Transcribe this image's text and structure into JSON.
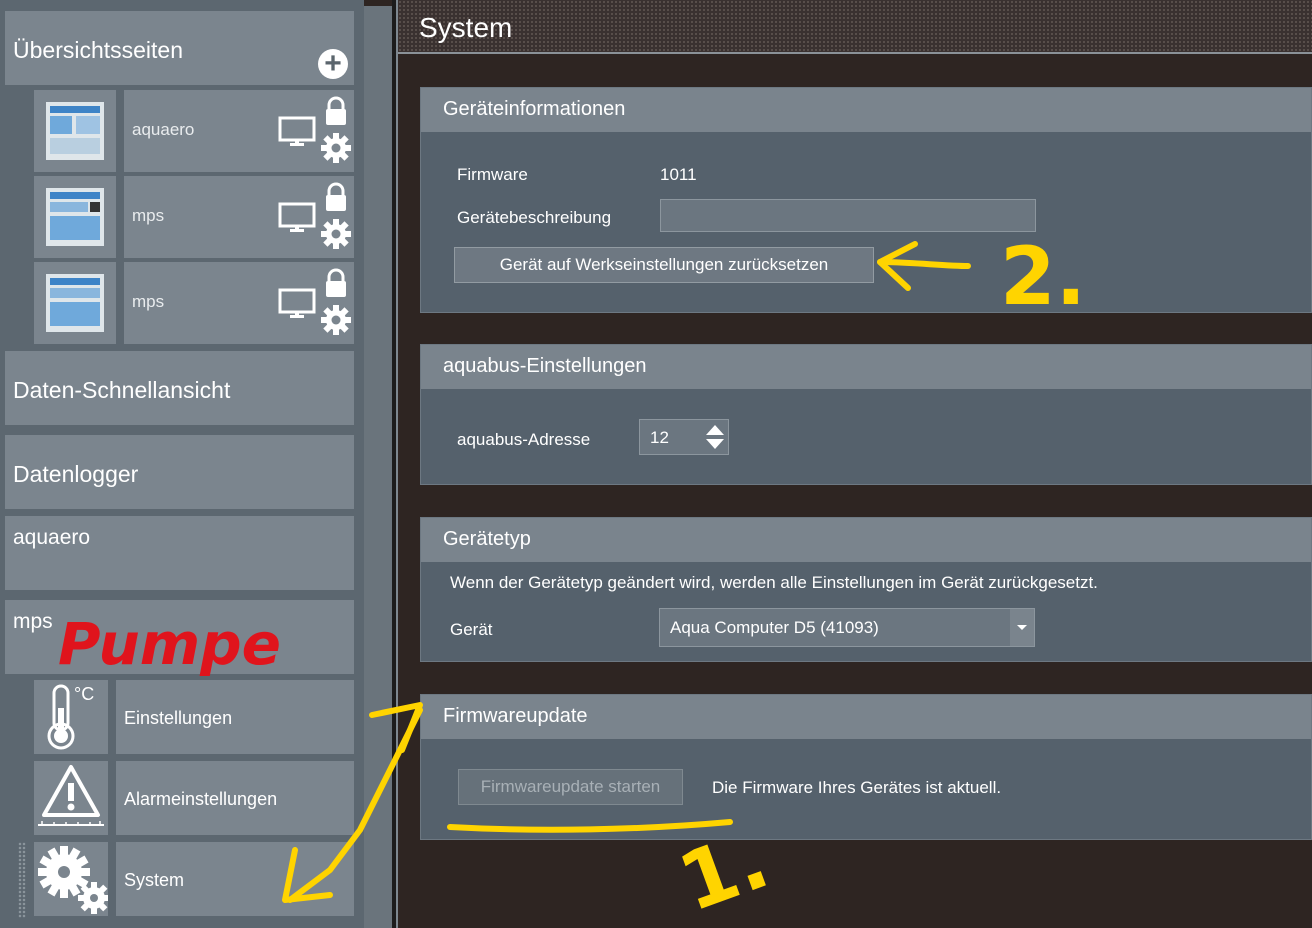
{
  "sidebar": {
    "overview_header": "Übersichtsseiten",
    "pages": [
      {
        "label": "aquaero"
      },
      {
        "label": "mps"
      },
      {
        "label": "mps"
      }
    ],
    "quick_view": "Daten-Schnellansicht",
    "datalogger": "Datenlogger",
    "device1": "aquaero",
    "device2": "mps",
    "sub_items": [
      {
        "label": "Einstellungen",
        "icon": "thermometer-icon"
      },
      {
        "label": "Alarmeinstellungen",
        "icon": "warning-icon"
      },
      {
        "label": "System",
        "icon": "gears-icon"
      }
    ],
    "celsius": "°C"
  },
  "title": "System",
  "sections": {
    "device_info": {
      "header": "Geräteinformationen",
      "firmware_label": "Firmware",
      "firmware_value": "1011",
      "description_label": "Gerätebeschreibung",
      "description_value": "",
      "reset_button": "Gerät auf Werkseinstellungen zurücksetzen"
    },
    "aquabus": {
      "header": "aquabus-Einstellungen",
      "address_label": "aquabus-Adresse",
      "address_value": "12"
    },
    "device_type": {
      "header": "Gerätetyp",
      "warning": "Wenn der Gerätetyp geändert wird, werden alle Einstellungen im Gerät zurückgesetzt.",
      "device_label": "Gerät",
      "device_value": "Aqua Computer D5 (41093)"
    },
    "firmware_update": {
      "header": "Firmwareupdate",
      "start_button": "Firmwareupdate starten",
      "status": "Die Firmware Ihres Gerätes ist aktuell."
    }
  },
  "annotations": {
    "pump_note": "Pumpe",
    "step1": "1.",
    "step2": "2.",
    "red": "#e0141c",
    "yellow": "#ffd400"
  }
}
